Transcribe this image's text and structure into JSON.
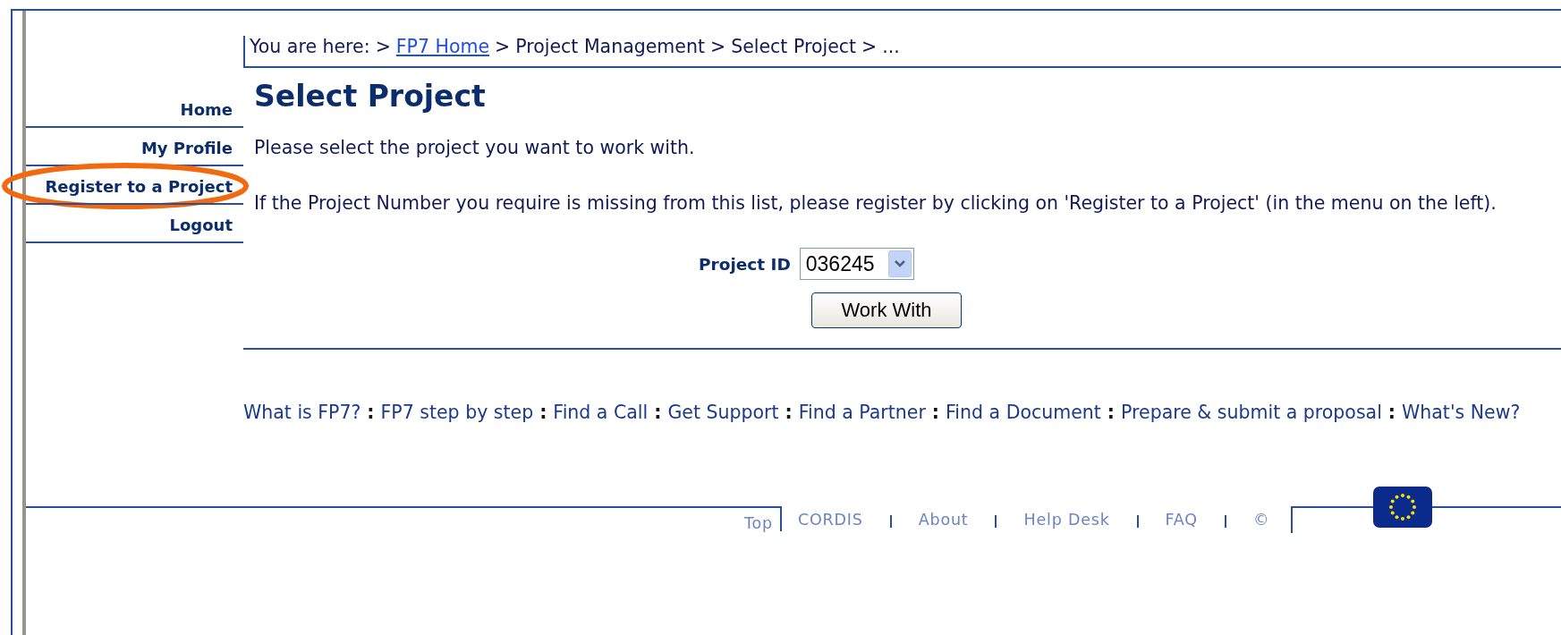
{
  "breadcrumb": {
    "label": "You are here:",
    "separator": ">",
    "items": [
      {
        "text": "FP7 Home",
        "link": true
      },
      {
        "text": "Project Management",
        "link": false
      },
      {
        "text": "Select Project",
        "link": false
      },
      {
        "text": "...",
        "link": false
      }
    ]
  },
  "sidebar": {
    "items": [
      {
        "label": "Home",
        "highlighted": false
      },
      {
        "label": "My Profile",
        "highlighted": false
      },
      {
        "label": "Register to a Project",
        "highlighted": true
      },
      {
        "label": "Logout",
        "highlighted": false
      }
    ]
  },
  "title": "Select Project",
  "paragraphs": [
    "Please select the project you want to work with.",
    "If the Project Number you require is missing from this list, please register by clicking on 'Register to a Project' (in the menu on the left)."
  ],
  "project_id": {
    "label": "Project ID",
    "value": "036245"
  },
  "button": "Work With",
  "footer_links": {
    "separator": ":",
    "items": [
      "What is FP7?",
      "FP7 step by step",
      "Find a Call",
      "Get Support",
      "Find a Partner",
      "Find a Document",
      "Prepare & submit a proposal",
      "What's New?"
    ]
  },
  "bottom_links": [
    "Top",
    "CORDIS",
    "About",
    "Help Desk",
    "FAQ",
    "©"
  ]
}
